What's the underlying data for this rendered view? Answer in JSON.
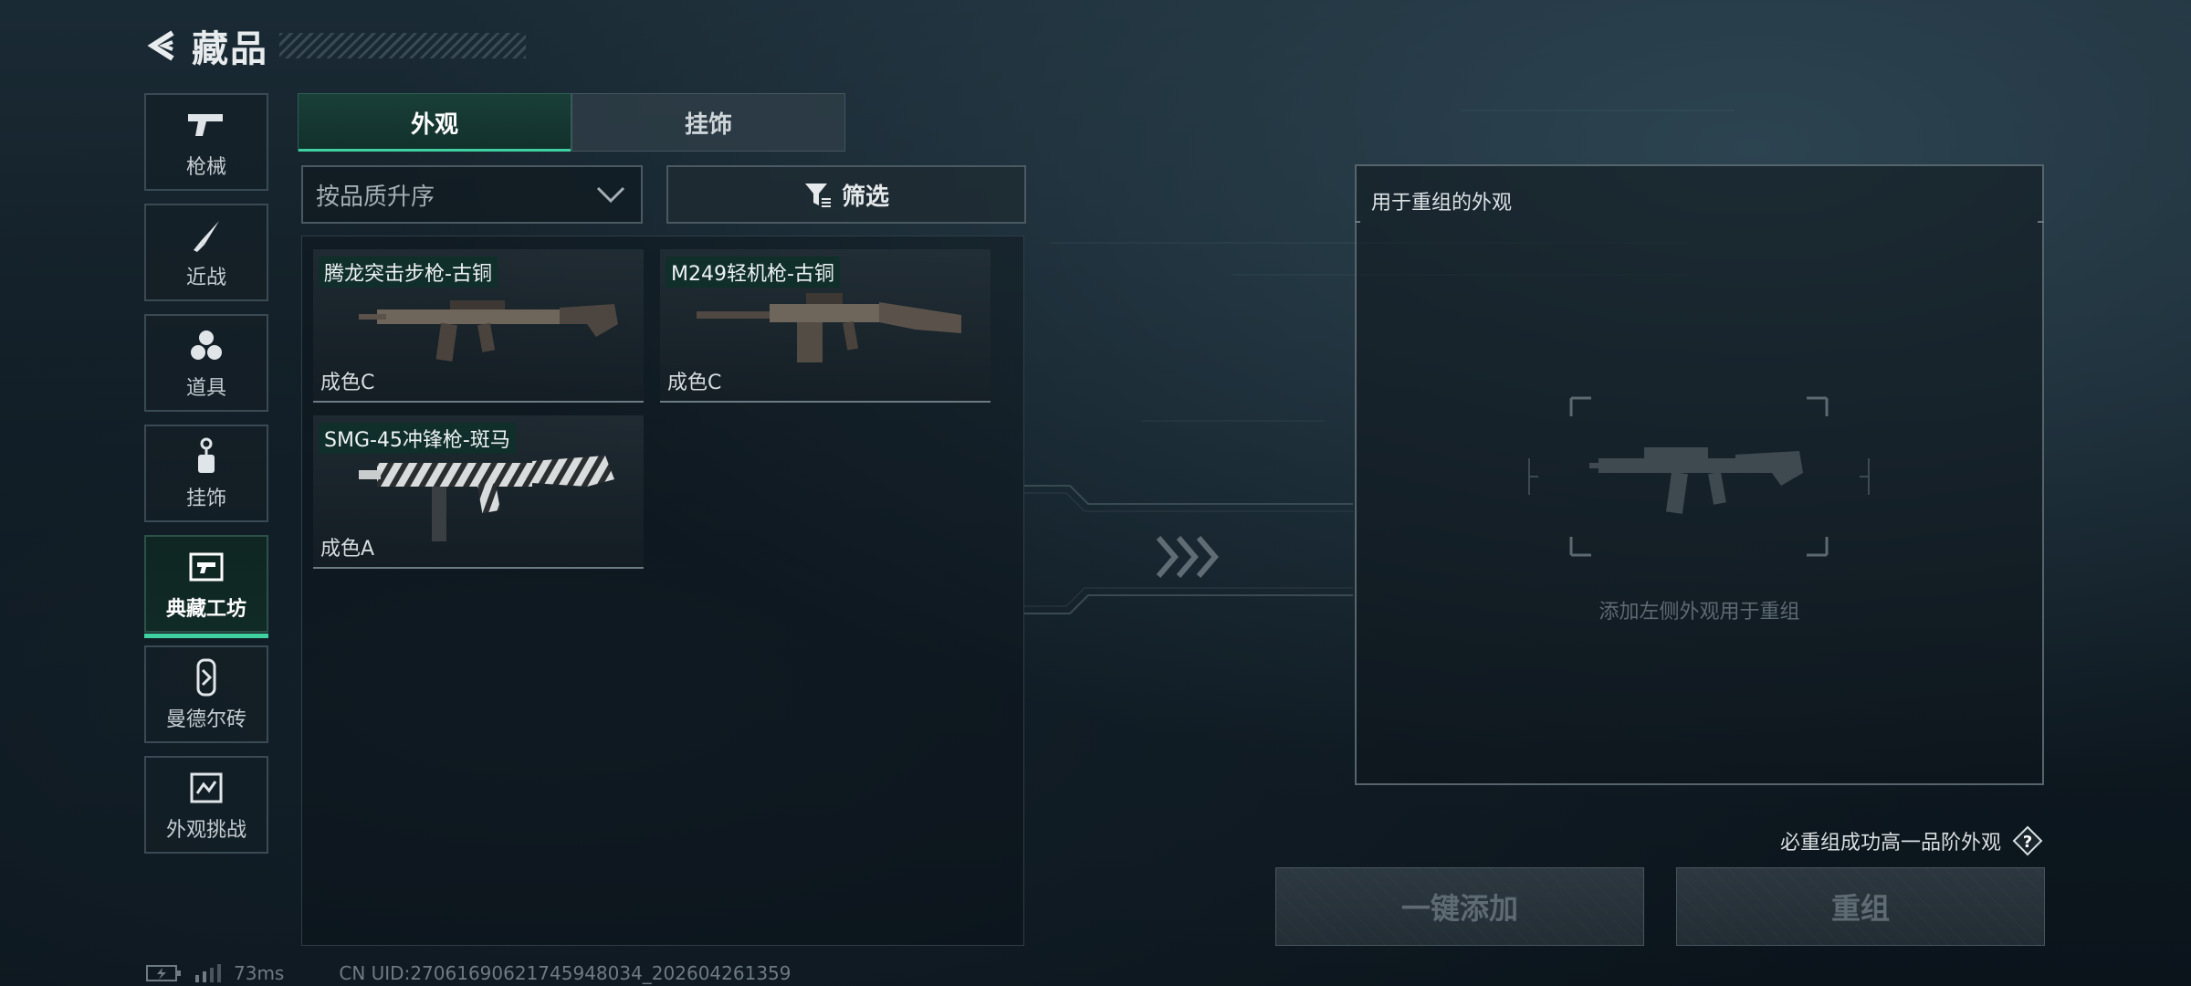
{
  "header": {
    "title": "藏品"
  },
  "sidebar": {
    "items": [
      {
        "label": "枪械",
        "icon": "gun-icon"
      },
      {
        "label": "近战",
        "icon": "knife-icon"
      },
      {
        "label": "道具",
        "icon": "grenade-icon"
      },
      {
        "label": "挂饰",
        "icon": "charm-icon"
      },
      {
        "label": "典藏工坊",
        "icon": "workshop-icon",
        "active": true
      },
      {
        "label": "曼德尔砖",
        "icon": "brick-icon"
      },
      {
        "label": "外观挑战",
        "icon": "challenge-icon"
      }
    ]
  },
  "tabs": [
    {
      "label": "外观",
      "active": true
    },
    {
      "label": "挂饰",
      "active": false
    }
  ],
  "sort": {
    "value": "按品质升序"
  },
  "filter": {
    "label": "筛选"
  },
  "items": [
    {
      "name": "腾龙突击步枪-古铜",
      "grade": "成色C"
    },
    {
      "name": "M249轻机枪-古铜",
      "grade": "成色C"
    },
    {
      "name": "SMG-45冲锋枪-斑马",
      "grade": "成色A"
    }
  ],
  "recombine": {
    "title": "用于重组的外观",
    "placeholder_hint": "添加左侧外观用于重组"
  },
  "hint": {
    "text": "必重组成功高一品阶外观",
    "help": "?"
  },
  "buttons": {
    "add_all": "一键添加",
    "recombine": "重组"
  },
  "status": {
    "ping": "73ms",
    "uid": "CN UID:27061690621745948034_202604261359"
  },
  "colors": {
    "accent": "#3fd1a0",
    "tag_bg": "#0e302a"
  }
}
